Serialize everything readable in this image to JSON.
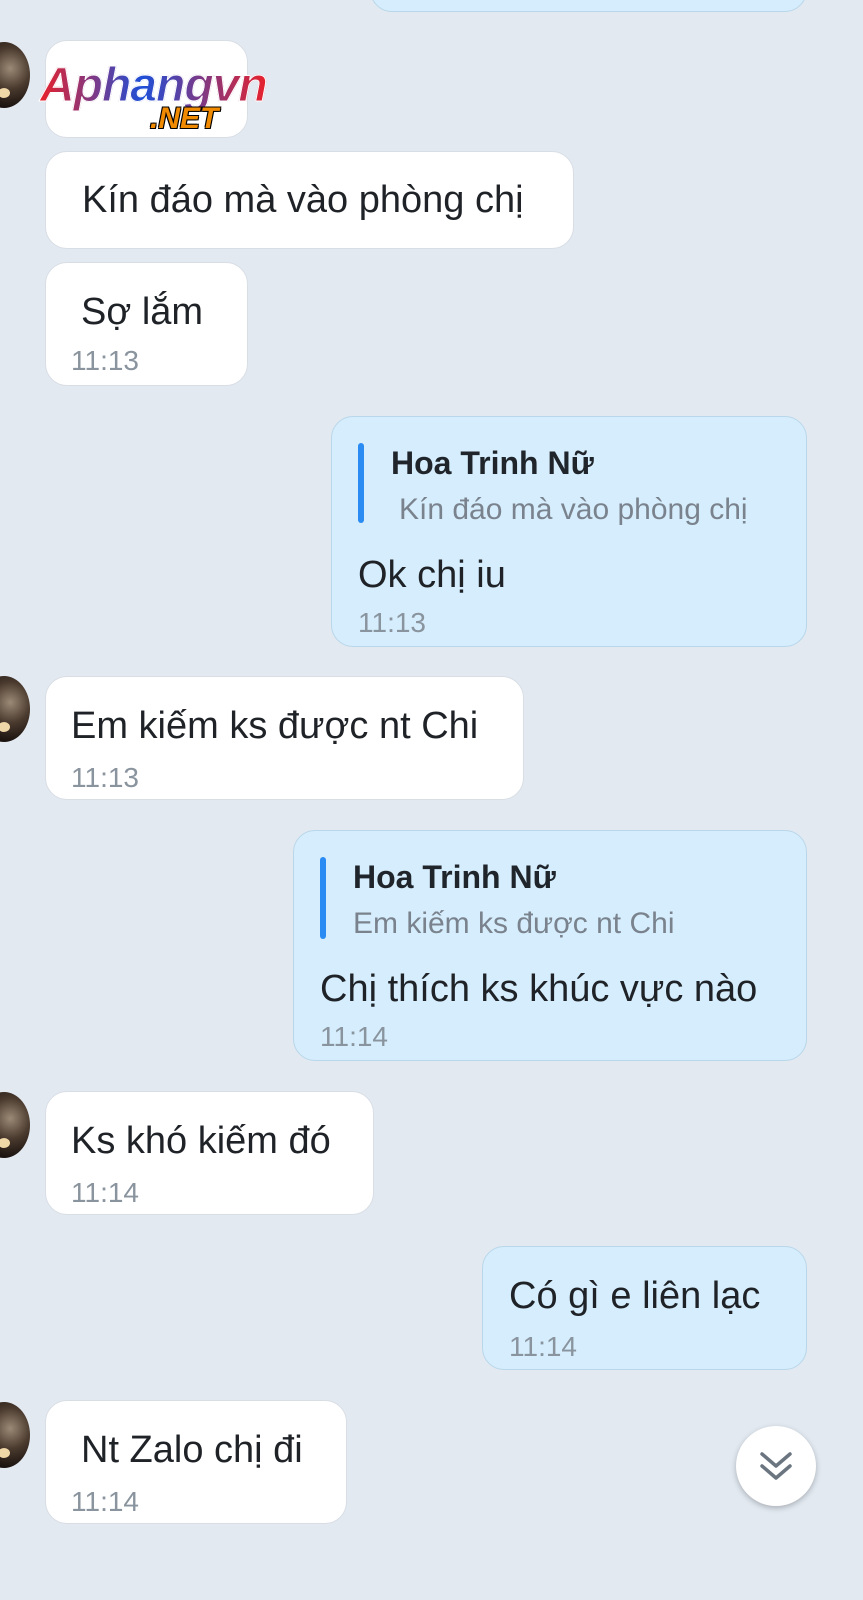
{
  "watermark": {
    "main": "Aphangvn",
    "suffix": ".NET"
  },
  "messages": [
    {
      "text": "Kín đáo mà vào phòng chị"
    },
    {
      "text": "Sợ lắm",
      "time": "11:13"
    },
    {
      "quote_name": "Hoa Trinh Nữ",
      "quote_text": "Kín đáo mà vào phòng chị",
      "text": "Ok chị iu",
      "time": "11:13"
    },
    {
      "text": "Em kiếm ks được nt Chi",
      "time": "11:13"
    },
    {
      "quote_name": "Hoa Trinh Nữ",
      "quote_text": "Em kiếm ks được nt Chi",
      "text": "Chị thích ks khúc vực nào",
      "time": "11:14"
    },
    {
      "text": "Ks khó kiếm đó",
      "time": "11:14"
    },
    {
      "text": "Có gì e liên lạc",
      "time": "11:14"
    },
    {
      "text": "Nt Zalo chị đi",
      "time": "11:14"
    }
  ],
  "colors": {
    "background": "#e2e9f1",
    "sent_bubble": "#d5edfc",
    "received_bubble": "#ffffff",
    "quote_bar": "#2a8bf2"
  },
  "icons": {
    "scroll_down": "double-chevron-down-icon"
  }
}
